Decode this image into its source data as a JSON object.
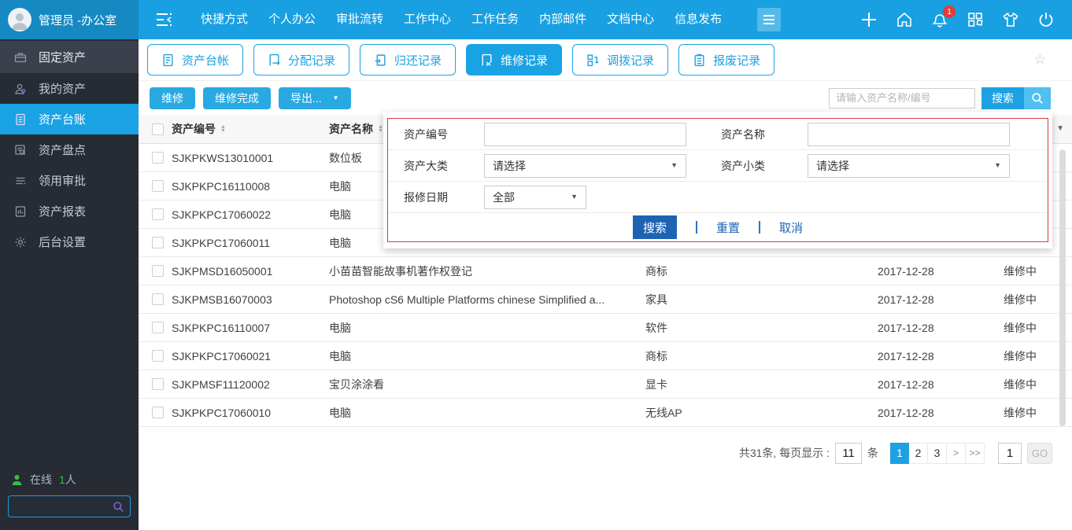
{
  "topbar": {
    "user_name": "管理员 -办公室",
    "nav_items": [
      "快捷方式",
      "个人办公",
      "审批流转",
      "工作中心",
      "工作任务",
      "内部邮件",
      "文档中心",
      "信息发布"
    ],
    "notification_count": "1"
  },
  "sidebar": {
    "items": [
      {
        "label": "固定资产",
        "icon": "briefcase-icon"
      },
      {
        "label": "我的资产",
        "icon": "person-icon"
      },
      {
        "label": "资产台账",
        "icon": "ledger-icon"
      },
      {
        "label": "资产盘点",
        "icon": "inventory-icon"
      },
      {
        "label": "领用审批",
        "icon": "approval-icon"
      },
      {
        "label": "资产报表",
        "icon": "report-icon"
      },
      {
        "label": "后台设置",
        "icon": "gear-icon"
      }
    ],
    "online_label": "在线",
    "online_count": "1",
    "online_unit": "人"
  },
  "tabs": [
    {
      "label": "资产台帐"
    },
    {
      "label": "分配记录"
    },
    {
      "label": "归还记录"
    },
    {
      "label": "维修记录"
    },
    {
      "label": "调拨记录"
    },
    {
      "label": "报废记录"
    }
  ],
  "toolbar": {
    "repair_label": "维修",
    "repair_done_label": "维修完成",
    "export_label": "导出...",
    "search_placeholder": "请输入资产名称/编号",
    "search_label": "搜索"
  },
  "filter_popup": {
    "asset_code_label": "资产编号",
    "asset_name_label": "资产名称",
    "category_label": "资产大类",
    "category_value": "请选择",
    "subcategory_label": "资产小类",
    "subcategory_value": "请选择",
    "repair_date_label": "报修日期",
    "repair_date_value": "全部",
    "search_label": "搜索",
    "reset_label": "重置",
    "cancel_label": "取消"
  },
  "table": {
    "col_code": "资产编号",
    "col_name": "资产名称",
    "rows": [
      {
        "code": "SJKPKWS13010001",
        "name": "数位板",
        "category": "",
        "date": "",
        "status": ""
      },
      {
        "code": "SJKPKPC16110008",
        "name": "电脑",
        "category": "",
        "date": "",
        "status": ""
      },
      {
        "code": "SJKPKPC17060022",
        "name": "电脑",
        "category": "",
        "date": "",
        "status": ""
      },
      {
        "code": "SJKPKPC17060011",
        "name": "电脑",
        "category": "",
        "date": "",
        "status": ""
      },
      {
        "code": "SJKPMSD16050001",
        "name": "小苗苗智能故事机著作权登记",
        "category": "商标",
        "date": "2017-12-28",
        "status": "维修中"
      },
      {
        "code": "SJKPMSB16070003",
        "name": "Photoshop cS6 Multiple Platforms chinese Simplified a...",
        "category": "家具",
        "date": "2017-12-28",
        "status": "维修中"
      },
      {
        "code": "SJKPKPC16110007",
        "name": "电脑",
        "category": "软件",
        "date": "2017-12-28",
        "status": "维修中"
      },
      {
        "code": "SJKPKPC17060021",
        "name": "电脑",
        "category": "商标",
        "date": "2017-12-28",
        "status": "维修中"
      },
      {
        "code": "SJKPMSF11120002",
        "name": "宝贝涂涂看",
        "category": "显卡",
        "date": "2017-12-28",
        "status": "维修中"
      },
      {
        "code": "SJKPKPC17060010",
        "name": "电脑",
        "category": "无线AP",
        "date": "2017-12-28",
        "status": "维修中"
      }
    ]
  },
  "pagination": {
    "summary": "共31条, 每页显示 :",
    "page_size": "11",
    "unit": "条",
    "page1": "1",
    "page2": "2",
    "page3": "3",
    "next": ">",
    "last": ">>",
    "goto_value": "1",
    "go_label": "GO"
  },
  "colors": {
    "topbar_blue": "#18a0e2",
    "accent_blue": "#1da1e2",
    "sidebar_dark": "#262b34",
    "popup_border_red": "#d93b3b",
    "popup_button_blue": "#1e63b2",
    "online_green": "#35c04a"
  }
}
